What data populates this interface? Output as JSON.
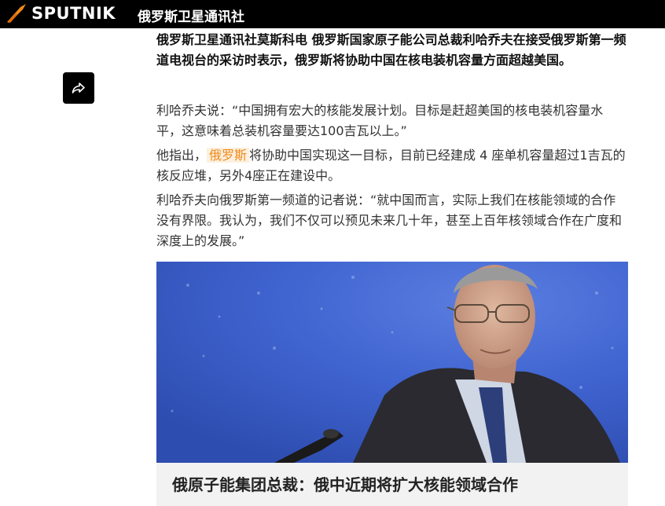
{
  "header": {
    "brand": "SPUTNIK",
    "site_name": "俄罗斯卫星通讯社"
  },
  "share": {
    "icon": "share-icon"
  },
  "article": {
    "lead": "俄罗斯卫星通讯社莫斯科电 俄罗斯国家原子能公司总裁利哈乔夫在接受俄罗斯第一频道电视台的采访时表示，俄罗斯将协助中国在核电装机容量方面超越美国。",
    "p1": "利哈乔夫说：“中国拥有宏大的核能发展计划。目标是赶超美国的核电装机容量水平，这意味着总装机容量要达100吉瓦以上。”",
    "p2_before": "他指出，",
    "p2_link": "俄罗斯",
    "p2_after": "将协助中国实现这一目标，目前已经建成 4 座单机容量超过1吉瓦的核反应堆，另外4座正在建设中。",
    "p3": "利哈乔夫向俄罗斯第一频道的记者说：“就中国而言，实际上我们在核能领域的合作没有界限。我认为，我们不仅可以预见未来几十年，甚至上百年核领域合作在广度和深度上的发展。”"
  },
  "related_card": {
    "title": "俄原子能集团总裁：俄中近期将扩大核能领域合作",
    "image_subject": "man-with-glasses-at-microphone"
  },
  "colors": {
    "topbar": "#000000",
    "accent": "#f08a1c",
    "highlight_bg": "#fdf0de",
    "card_bg": "#f2f2f2"
  }
}
